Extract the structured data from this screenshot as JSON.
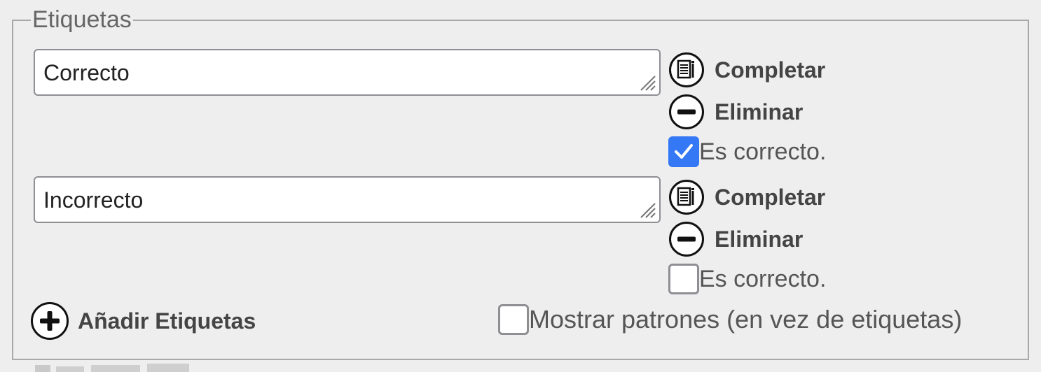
{
  "group": {
    "legend": "Etiquetas"
  },
  "labels": [
    {
      "value": "Correcto",
      "complete_label": "Completar",
      "delete_label": "Eliminar",
      "correct_label": "Es correcto.",
      "correct_checked": true
    },
    {
      "value": "Incorrecto",
      "complete_label": "Completar",
      "delete_label": "Eliminar",
      "correct_label": "Es correcto.",
      "correct_checked": false
    }
  ],
  "add_label": "Añadir Etiquetas",
  "show_patterns": {
    "label": "Mostrar patrones (en vez de etiquetas)",
    "checked": false
  },
  "icons": {
    "complete": "notebook-icon",
    "delete": "minus-circle-icon",
    "add": "plus-circle-icon",
    "check": "checkmark-icon"
  },
  "colors": {
    "checkbox_checked": "#3478f6",
    "background": "#eeeeee"
  }
}
